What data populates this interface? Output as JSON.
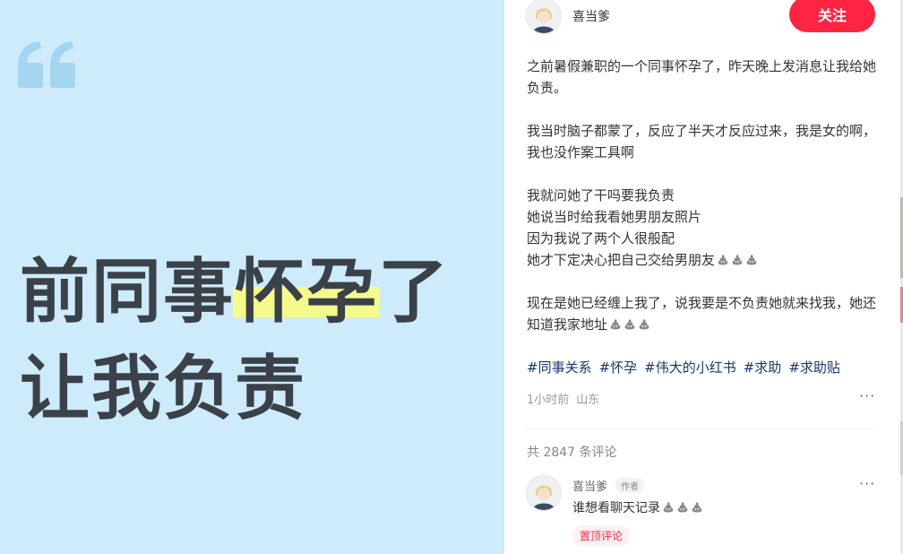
{
  "cover": {
    "headline_part1": "前同事",
    "headline_highlight": "怀孕",
    "headline_part2": "了",
    "headline_line2": "让我负责",
    "quote_icon": "quote-mark-icon",
    "bg_color": "#cdebfb",
    "highlight_color": "#f4fb8a"
  },
  "author": {
    "name": "喜当爹",
    "avatar_icon": "user-avatar-icon",
    "follow_label": "关注",
    "follow_color": "#ff2442"
  },
  "post": {
    "paragraphs": [
      [
        "之前暑假兼职的一个同事怀孕了，昨天晚上发消息让我给她负责。"
      ],
      [
        "我当时脑子都蒙了，反应了半天才反应过来，我是女的啊，我也没作案工具啊"
      ],
      [
        "我就问她了干吗要我负责",
        "她说当时给我看她男朋友照片",
        "因为我说了两个人很般配",
        "她才下定决心把自己交给男朋友"
      ],
      [
        "现在是她已经缠上我了，说我要是不负责她就来找我，她还知道我家地址"
      ]
    ],
    "emoji_icon": "poop-emoji-icon",
    "tags": [
      "#同事关系",
      "#怀孕",
      "#伟大的小红书",
      "#求助",
      "#求助贴"
    ],
    "time": "1小时前",
    "location": "山东",
    "more_icon": "more-dots-icon"
  },
  "comments": {
    "count_text": "共 2847 条评论",
    "items": [
      {
        "name": "喜当爹",
        "badge": "作者",
        "text": "谁想看聊天记录",
        "pin_label": "置顶评论"
      }
    ]
  }
}
